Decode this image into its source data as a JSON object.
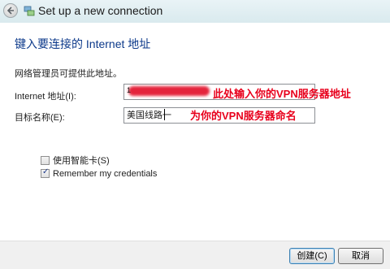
{
  "window": {
    "title": "Set up a new connection"
  },
  "heading": "键入要连接的 Internet 地址",
  "description": "网络管理员可提供此地址。",
  "form": {
    "address_label": "Internet 地址(I):",
    "address_value": "1",
    "name_label": "目标名称(E):",
    "name_value": "美国线路一"
  },
  "annotations": {
    "address_note": "此处输入你的VPN服务器地址",
    "name_note": "为你的VPN服务器命名",
    "color": "#e8001c"
  },
  "options": {
    "smart_card_label": "使用智能卡(S)",
    "smart_card_checked": false,
    "remember_label": "Remember my credentials",
    "remember_checked": true
  },
  "buttons": {
    "create_label": "创建(C)",
    "cancel_label": "取消"
  },
  "icons": {
    "back": "back-arrow-icon",
    "app": "network-connection-icon"
  }
}
